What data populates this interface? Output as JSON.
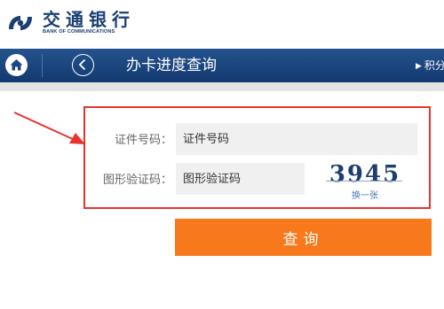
{
  "brand": {
    "name_cn": "交通银行",
    "name_en": "BANK OF COMMUNICATIONS"
  },
  "nav": {
    "home_icon": "home-icon",
    "back_icon": "chevron-left-icon",
    "title": "办卡进度查询",
    "right_link": "积分"
  },
  "form": {
    "id_label": "证件号码：",
    "id_placeholder": "证件号码",
    "captcha_label": "图形验证码：",
    "captcha_placeholder": "图形验证码",
    "captcha_code": "3945",
    "captcha_refresh": "换一张",
    "submit_label": "查询"
  },
  "colors": {
    "nav_bg": "#1b4680",
    "brand_blue": "#1a3f73",
    "submit_bg": "#f7791b",
    "highlight_border": "#e8322e",
    "field_bg": "#f0f0f0"
  }
}
